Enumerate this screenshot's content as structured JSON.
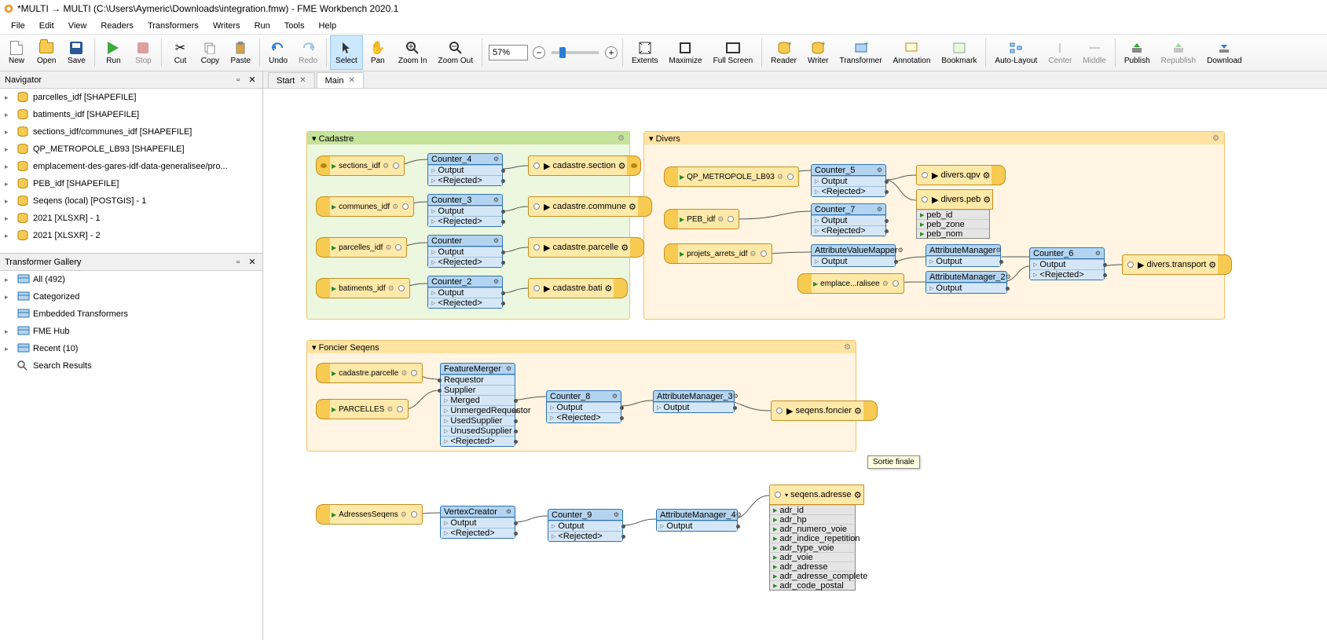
{
  "title": "*MULTI → MULTI (C:\\Users\\Aymeric\\Downloads\\integration.fmw) - FME Workbench 2020.1",
  "menu": [
    "File",
    "Edit",
    "View",
    "Readers",
    "Transformers",
    "Writers",
    "Run",
    "Tools",
    "Help"
  ],
  "toolbar": [
    {
      "label": "New",
      "icon": "file"
    },
    {
      "label": "Open",
      "icon": "open"
    },
    {
      "label": "Save",
      "icon": "save"
    },
    {
      "sep": true
    },
    {
      "label": "Run",
      "icon": "run"
    },
    {
      "label": "Stop",
      "icon": "stop",
      "disabled": true
    },
    {
      "sep": true
    },
    {
      "label": "Cut",
      "icon": "cut"
    },
    {
      "label": "Copy",
      "icon": "copy"
    },
    {
      "label": "Paste",
      "icon": "paste"
    },
    {
      "sep": true
    },
    {
      "label": "Undo",
      "icon": "undo"
    },
    {
      "label": "Redo",
      "icon": "redo",
      "disabled": true
    },
    {
      "sep": true
    },
    {
      "label": "Select",
      "icon": "select",
      "active": true
    },
    {
      "label": "Pan",
      "icon": "pan"
    },
    {
      "label": "Zoom In",
      "icon": "zoomin"
    },
    {
      "label": "Zoom Out",
      "icon": "zoomout"
    },
    {
      "sep": true
    },
    {
      "zoom": true,
      "value": "57%"
    },
    {
      "sep": true
    },
    {
      "label": "Extents",
      "icon": "extents"
    },
    {
      "label": "Maximize",
      "icon": "maximize"
    },
    {
      "label": "Full Screen",
      "icon": "fullscreen"
    },
    {
      "sep": true
    },
    {
      "label": "Reader",
      "icon": "reader"
    },
    {
      "label": "Writer",
      "icon": "writer"
    },
    {
      "label": "Transformer",
      "icon": "transformer"
    },
    {
      "label": "Annotation",
      "icon": "annotation"
    },
    {
      "label": "Bookmark",
      "icon": "bookmark"
    },
    {
      "sep": true
    },
    {
      "label": "Auto-Layout",
      "icon": "autolayout"
    },
    {
      "label": "Center",
      "icon": "center",
      "disabled": true
    },
    {
      "label": "Middle",
      "icon": "middle",
      "disabled": true
    },
    {
      "sep": true
    },
    {
      "label": "Publish",
      "icon": "publish"
    },
    {
      "label": "Republish",
      "icon": "republish",
      "disabled": true
    },
    {
      "label": "Download",
      "icon": "download"
    }
  ],
  "panels": {
    "navigator": "Navigator",
    "gallery": "Transformer Gallery"
  },
  "navigator": [
    "parcelles_idf [SHAPEFILE]",
    "batiments_idf [SHAPEFILE]",
    "sections_idf/communes_idf [SHAPEFILE]",
    "QP_METROPOLE_LB93 [SHAPEFILE]",
    "emplacement-des-gares-idf-data-generalisee/pro...",
    "PEB_idf [SHAPEFILE]",
    "Seqens (local) [POSTGIS] - 1",
    "2021 [XLSXR] - 1",
    "2021 [XLSXR] - 2"
  ],
  "gallery": [
    {
      "label": "All (492)",
      "expandable": true
    },
    {
      "label": "Categorized",
      "expandable": true
    },
    {
      "label": "Embedded Transformers",
      "expandable": false
    },
    {
      "label": "FME Hub",
      "expandable": true
    },
    {
      "label": "Recent (10)",
      "expandable": true
    },
    {
      "label": "Search Results",
      "expandable": false,
      "icon": "search"
    }
  ],
  "tabs": [
    {
      "label": "Start",
      "active": false
    },
    {
      "label": "Main",
      "active": true
    }
  ],
  "bookmarks": {
    "cadastre": "Cadastre",
    "divers": "Divers",
    "foncier": "Foncier Seqens"
  },
  "tooltip": "Sortie finale",
  "readers": {
    "sections_idf": "sections_idf",
    "communes_idf": "communes_idf",
    "parcelles_idf": "parcelles_idf",
    "batiments_idf": "batiments_idf",
    "qp": "QP_METROPOLE_LB93",
    "peb": "PEB_idf",
    "projets": "projets_arrets_idf",
    "emplace": "emplace...ralisee",
    "cad_parcelle": "cadastre.parcelle",
    "parcelles_caps": "PARCELLES",
    "adresses": "AdressesSeqens"
  },
  "writers": {
    "cad_section": "cadastre.section",
    "cad_commune": "cadastre.commune",
    "cad_parcelle": "cadastre.parcelle",
    "cad_bati": "cadastre.bati",
    "div_qpv": "divers.qpv",
    "div_peb": "divers.peb",
    "div_transport": "divers.transport",
    "seq_foncier": "seqens.foncier",
    "seq_adresse": "seqens.adresse"
  },
  "writer_attrs": {
    "peb": [
      "peb_id",
      "peb_zone",
      "peb_nom"
    ],
    "adresse": [
      "adr_id",
      "adr_hp",
      "adr_numero_voie",
      "adr_indice_repetition",
      "adr_type_voie",
      "adr_voie",
      "adr_adresse",
      "adr_adresse_complete",
      "adr_code_postal"
    ]
  },
  "transformers": {
    "counter": "Counter",
    "counter2": "Counter_2",
    "counter3": "Counter_3",
    "counter4": "Counter_4",
    "counter5": "Counter_5",
    "counter6": "Counter_6",
    "counter7": "Counter_7",
    "counter8": "Counter_8",
    "counter9": "Counter_9",
    "avm": "AttributeValueMapper",
    "am": "AttributeManager",
    "am2": "AttributeManager_2",
    "am3": "AttributeManager_3",
    "am4": "AttributeManager_4",
    "fm": "FeatureMerger",
    "vc": "VertexCreator"
  },
  "ports": {
    "output": "Output",
    "rejected": "<Rejected>",
    "requestor": "Requestor",
    "supplier": "Supplier",
    "merged": "Merged",
    "unmerged": "UnmergedRequestor",
    "usedsup": "UsedSupplier",
    "unusedsup": "UnusedSupplier"
  }
}
